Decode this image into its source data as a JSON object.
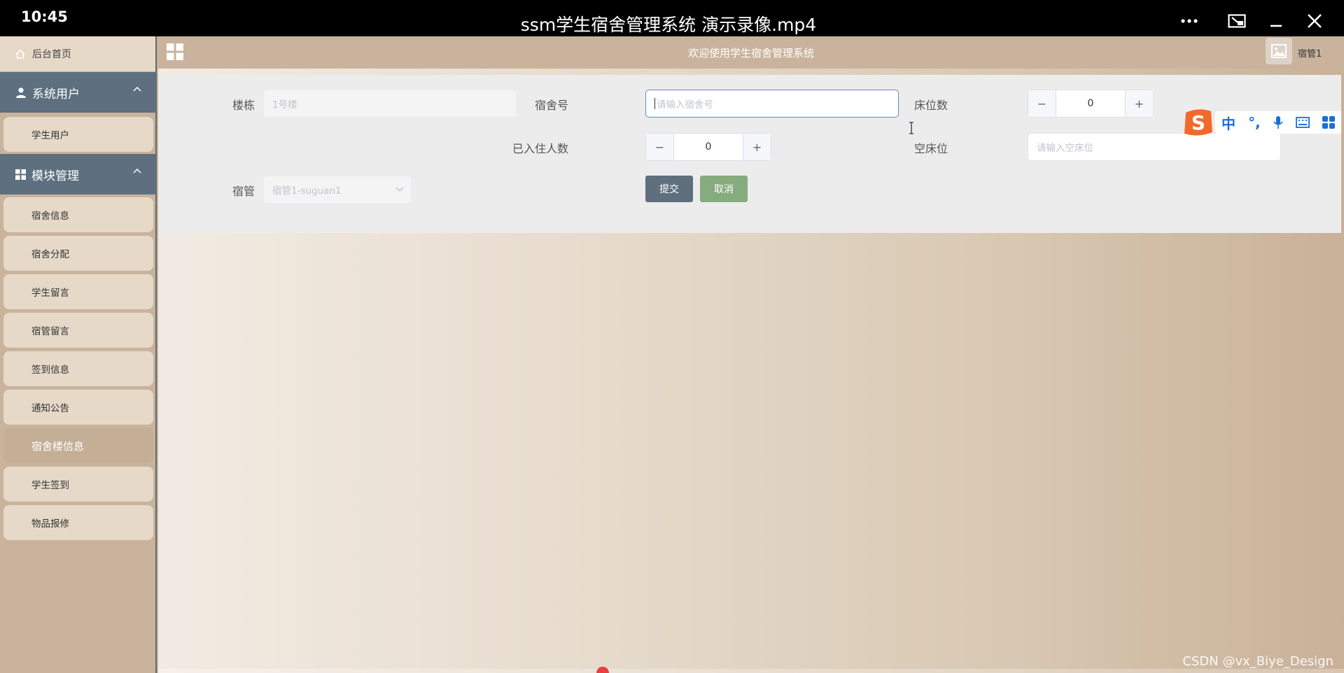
{
  "player": {
    "time": "10:45",
    "title": "ssm学生宿舍管理系统 演示录像.mp4"
  },
  "header": {
    "welcome": "欢迎使用学生宿舍管理系统",
    "user": "宿管1"
  },
  "sidebar": {
    "home": "后台首页",
    "groups": [
      {
        "label": "系统用户",
        "items": [
          "学生用户"
        ]
      },
      {
        "label": "模块管理",
        "items": [
          "宿舍信息",
          "宿舍分配",
          "学生留言",
          "宿管留言",
          "签到信息",
          "通知公告",
          "宿舍楼信息",
          "学生签到",
          "物品报修"
        ]
      }
    ],
    "active_item": "宿舍楼信息"
  },
  "form": {
    "building": {
      "label": "楼栋",
      "value": "1号楼"
    },
    "room_no": {
      "label": "宿舍号",
      "placeholder": "请输入宿舍号"
    },
    "beds": {
      "label": "床位数",
      "value": "0"
    },
    "occupied": {
      "label": "已入住人数",
      "value": "0"
    },
    "vacant": {
      "label": "空床位",
      "placeholder": "请输入空床位"
    },
    "manager": {
      "label": "宿管",
      "value": "宿管1-suguan1"
    },
    "submit_label": "提交",
    "cancel_label": "取消"
  },
  "ime": {
    "mode": "中",
    "punct": "°,"
  },
  "watermark": "CSDN @vx_Biye_Design",
  "colors": {
    "sidebar_group": "#5e7080",
    "submit": "#5f6f7e",
    "cancel": "#86ab7d",
    "focus_border": "#5b8ac7"
  }
}
